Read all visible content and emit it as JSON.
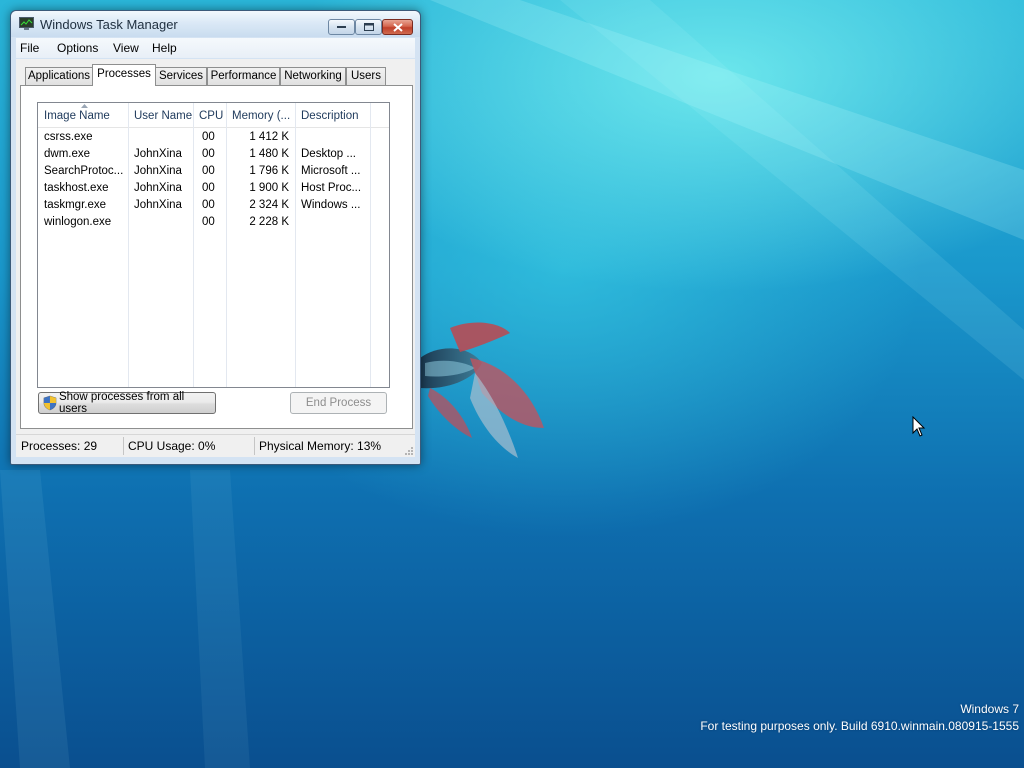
{
  "window": {
    "title": "Windows Task Manager"
  },
  "menu": [
    "File",
    "Options",
    "View",
    "Help"
  ],
  "tabs": [
    {
      "label": "Applications",
      "active": false
    },
    {
      "label": "Processes",
      "active": true
    },
    {
      "label": "Services",
      "active": false
    },
    {
      "label": "Performance",
      "active": false
    },
    {
      "label": "Networking",
      "active": false
    },
    {
      "label": "Users",
      "active": false
    }
  ],
  "table": {
    "columns": [
      "Image Name",
      "User Name",
      "CPU",
      "Memory (...",
      "Description"
    ],
    "rows": [
      {
        "image": "csrss.exe",
        "user": "",
        "cpu": "00",
        "memory": "1 412 K",
        "description": ""
      },
      {
        "image": "dwm.exe",
        "user": "JohnXina",
        "cpu": "00",
        "memory": "1 480 K",
        "description": "Desktop ..."
      },
      {
        "image": "SearchProtoc...",
        "user": "JohnXina",
        "cpu": "00",
        "memory": "1 796 K",
        "description": "Microsoft ..."
      },
      {
        "image": "taskhost.exe",
        "user": "JohnXina",
        "cpu": "00",
        "memory": "1 900 K",
        "description": "Host Proc..."
      },
      {
        "image": "taskmgr.exe",
        "user": "JohnXina",
        "cpu": "00",
        "memory": "2 324 K",
        "description": "Windows ..."
      },
      {
        "image": "winlogon.exe",
        "user": "",
        "cpu": "00",
        "memory": "2 228 K",
        "description": ""
      }
    ]
  },
  "buttons": {
    "show_all": "Show processes from all users",
    "end_process": "End Process"
  },
  "status": {
    "processes": "Processes: 29",
    "cpu": "CPU Usage: 0%",
    "memory": "Physical Memory: 13%"
  },
  "desktop": {
    "watermark_line1": "Windows 7",
    "watermark_line2": "For testing purposes only. Build 6910.winmain.080915-1555"
  },
  "icons": {
    "title": "task-manager-icon",
    "sort": "sort-ascending-icon",
    "shield": "uac-shield-icon",
    "cursor": "mouse-pointer-icon"
  },
  "colors": {
    "desktop_top": "#2ab6d9",
    "desktop_bottom": "#0a4f8f",
    "window_frame": "#d4e3f3",
    "close_button": "#c0402a",
    "header_text": "#1e395b"
  }
}
